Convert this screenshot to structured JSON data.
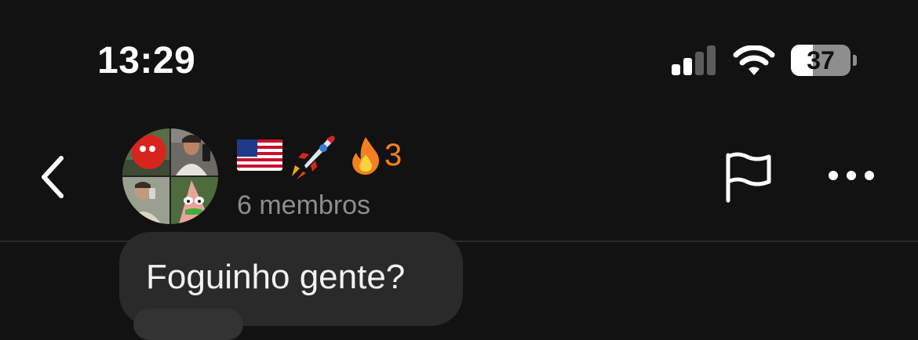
{
  "status_bar": {
    "time": "13:29",
    "battery_level": "37",
    "battery_fraction": 0.37,
    "signal_bars_active": 2,
    "signal_bars_total": 4,
    "icons": [
      "cellular-signal-icon",
      "wifi-icon",
      "battery-icon"
    ]
  },
  "header": {
    "back_icon": "chevron-left-icon",
    "title_emojis": [
      "us-flag",
      "rocket",
      "fire"
    ],
    "streak_count": "3",
    "members_label": "6 membros",
    "report_icon": "flag-icon",
    "more_icon": "ellipsis-icon"
  },
  "messages": [
    {
      "text": "Foguinho gente?"
    }
  ],
  "colors": {
    "background": "#121212",
    "bubble": "#2a2a2a",
    "streak": "#f5801f",
    "muted_text": "#8d8d8d"
  }
}
